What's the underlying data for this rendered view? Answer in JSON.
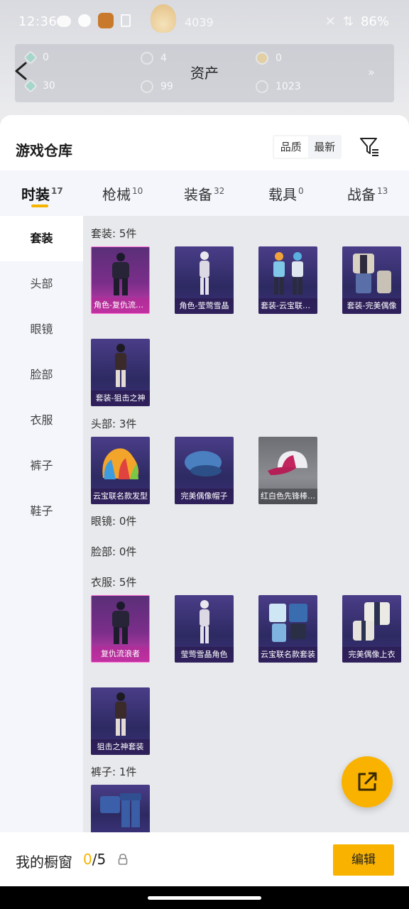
{
  "status_bar": {
    "time": "12:36",
    "hero_center_text": "4039",
    "battery": "86%"
  },
  "assets": {
    "title": "资产",
    "items": [
      {
        "value": "0",
        "icon": "gem-icon"
      },
      {
        "value": "4",
        "icon": "silver-coin-icon"
      },
      {
        "value": "0",
        "icon": "gold-coin-icon"
      },
      {
        "value": "30",
        "icon": "gem-icon"
      },
      {
        "value": "99",
        "icon": "silver-coin-icon"
      },
      {
        "value": "1023",
        "icon": "silver-coin-icon"
      }
    ],
    "more": "»"
  },
  "warehouse": {
    "title": "游戏仓库",
    "sort_options": [
      "品质",
      "最新"
    ],
    "active_sort": "品质"
  },
  "tabs": [
    {
      "label": "时装",
      "count": "17"
    },
    {
      "label": "枪械",
      "count": "10"
    },
    {
      "label": "装备",
      "count": "32"
    },
    {
      "label": "载具",
      "count": "0"
    },
    {
      "label": "战备",
      "count": "13"
    }
  ],
  "side_nav": [
    "套装",
    "头部",
    "眼镜",
    "脸部",
    "衣服",
    "裤子",
    "鞋子"
  ],
  "sections": {
    "suits": {
      "label": "套装: 5件",
      "items": [
        "角色-复仇流浪者",
        "角色-莹莺雪晶",
        "套装-云宝联名款",
        "套装-完美偶像",
        "套装-狙击之神"
      ]
    },
    "head": {
      "label": "头部: 3件",
      "items": [
        "云宝联名款发型",
        "完美偶像帽子",
        "红白色先锋棒球帽"
      ]
    },
    "glasses": {
      "label": "眼镜: 0件"
    },
    "face": {
      "label": "脸部: 0件"
    },
    "clothes": {
      "label": "衣服: 5件",
      "items": [
        "复仇流浪者",
        "莹莺雪晶角色",
        "云宝联名款套装",
        "完美偶像上衣",
        "狙击之神套装"
      ]
    },
    "pants": {
      "label": "裤子: 1件"
    }
  },
  "wardrobe": {
    "label": "我的橱窗",
    "current": "0",
    "total": "/5",
    "edit_label": "编辑"
  },
  "colors": {
    "accent": "#f9b200",
    "rarity_pink": "#d23fb0",
    "rarity_purple": "#3a3178"
  }
}
